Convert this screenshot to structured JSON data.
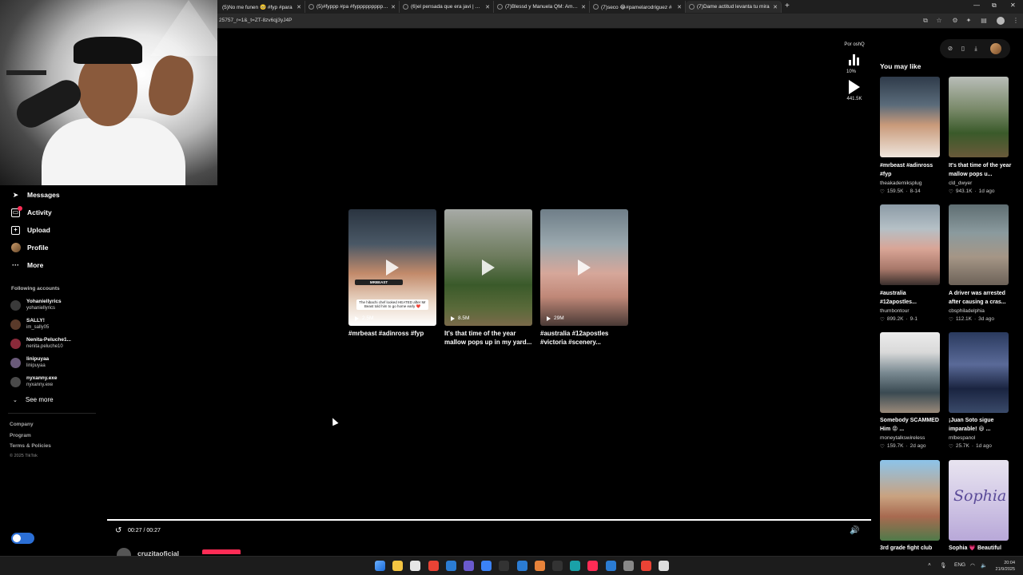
{
  "browser": {
    "tabs": [
      {
        "label": "(5)No me funen 🥺 #fyp #para"
      },
      {
        "label": "(5)#fyppp #pa #fyppppppppppp"
      },
      {
        "label": "(6)el pensada que era javi | TikTok"
      },
      {
        "label": "(7)Blessd y Manuela QM: Amor y"
      },
      {
        "label": "(7)seco 😂#pamelarodriguez #"
      },
      {
        "label": "(7)Dame actitud levanta tu mira"
      }
    ],
    "new_tab": "+",
    "url": "25757_r=1&_t=ZT-8zv6qj3yJ4P",
    "window_controls": [
      "—",
      "⧉",
      "✕"
    ]
  },
  "sidebar": {
    "nav": [
      {
        "label": "Messages",
        "icon": "send-icon"
      },
      {
        "label": "Activity",
        "icon": "inbox-icon"
      },
      {
        "label": "Upload",
        "icon": "plus-square-icon"
      },
      {
        "label": "Profile",
        "icon": "avatar-icon"
      },
      {
        "label": "More",
        "icon": "ellipsis-icon"
      }
    ],
    "following_title": "Following accounts",
    "accounts": [
      {
        "name": "Yohaniellyrics",
        "handle": "yohaniellyrics",
        "color": "#3a3a3a"
      },
      {
        "name": "SALLY!",
        "handle": "im_sally05",
        "color": "#5a3a2a"
      },
      {
        "name": "Nenita-Peluche1...",
        "handle": "nenita.peluche10",
        "color": "#8a2a3a"
      },
      {
        "name": "linipuyaa",
        "handle": "linipuyaa",
        "color": "#6a5a7a"
      },
      {
        "name": "nyxanny.exe",
        "handle": "nyxanny.exe",
        "color": "#4a4a4a"
      }
    ],
    "see_more": "See more",
    "footer": [
      "Company",
      "Program",
      "Terms & Policies"
    ],
    "copyright": "© 2025 TikTok"
  },
  "related": [
    {
      "views": "2.5M",
      "caption": "#mrbeast #adinross #fyp",
      "overlay": "The hibachi chef looked HEATED after Mr Beast told him to go home early ❤️",
      "brand": "MRBEAST"
    },
    {
      "views": "8.5M",
      "caption": "It's that time of the year mallow pops up in my yard..."
    },
    {
      "views": "29M",
      "caption": "#australia #12apostles #victoria #scenery..."
    }
  ],
  "video_actions": {
    "author_tag": "Por oshQ",
    "percent": "10%",
    "plays": "441.5K"
  },
  "player": {
    "progress": 1.0,
    "time": "00:27 / 00:27",
    "author_peek": "cruzitaoficial"
  },
  "right_panel": {
    "title": "You may like",
    "items": [
      {
        "title": "#mrbeast #adinross #fyp",
        "author": "theakademiksplug",
        "likes": "159.5K",
        "date": "8-14",
        "colors": [
          "#3d4c5e",
          "#f2e9e2"
        ]
      },
      {
        "title": "It's that time of the year mallow pops u...",
        "author": "cld_dwyer",
        "likes": "943.1K",
        "date": "1d ago",
        "colors": [
          "#7a8a6a",
          "#3a4a2a"
        ]
      },
      {
        "title": "#australia #12apostles...",
        "author": "thumbontour",
        "likes": "899.2K",
        "date": "9-1",
        "colors": [
          "#9aa9b6",
          "#c9a090"
        ]
      },
      {
        "title": "A driver was arrested after causing a cras...",
        "author": "cbsphiladelphia",
        "likes": "112.1K",
        "date": "3d ago",
        "colors": [
          "#6d7f86",
          "#9b8f84"
        ]
      },
      {
        "title": "Somebody SCAMMED Him 😡 ...",
        "author": "moneytalkswireless",
        "likes": "159.7K",
        "date": "2d ago",
        "colors": [
          "#dcdcdc",
          "#3a5a6a"
        ]
      },
      {
        "title": "¡Juan Soto sigue imparable! 😃 ...",
        "author": "mlbespanol",
        "likes": "25.7K",
        "date": "1d ago",
        "colors": [
          "#1a2a4a",
          "#6a7aa0"
        ]
      },
      {
        "title": "3rd grade fight club",
        "author": "",
        "likes": "",
        "date": "",
        "colors": [
          "#6aa7d8",
          "#d8a070"
        ]
      },
      {
        "title": "Sophia 💗 Beautiful",
        "author": "",
        "likes": "",
        "date": "",
        "colors": [
          "#d8d2e8",
          "#6a5a9a"
        ],
        "overlay": "Sophia"
      }
    ]
  },
  "taskbar": {
    "lang": "ENG",
    "time": "20:04",
    "date": "21/9/2025",
    "apps": [
      "#3b82f6",
      "#f5c542",
      "#e5e5e5",
      "#ea4335",
      "#2b7cd3",
      "#6a5acd",
      "#3b82f6",
      "#333",
      "#2b7cd3",
      "#e8833a",
      "#333",
      "#1aa1a8",
      "#fe2c55",
      "#2b7cd3",
      "#888",
      "#ea4335",
      "#ddd"
    ]
  }
}
